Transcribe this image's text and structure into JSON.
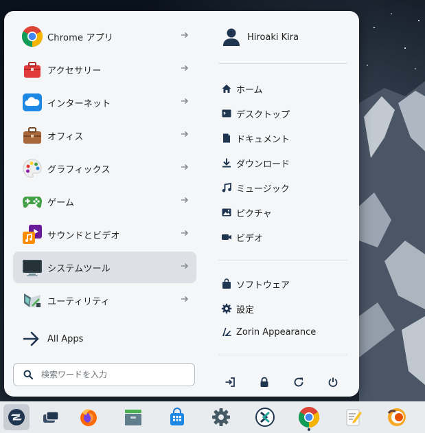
{
  "menu": {
    "categories": [
      {
        "label": "Chrome アプリ",
        "icon": "chrome-icon"
      },
      {
        "label": "アクセサリー",
        "icon": "toolbox-icon"
      },
      {
        "label": "インターネット",
        "icon": "cloud-icon"
      },
      {
        "label": "オフィス",
        "icon": "briefcase-icon"
      },
      {
        "label": "グラフィックス",
        "icon": "palette-icon"
      },
      {
        "label": "ゲーム",
        "icon": "gamepad-icon"
      },
      {
        "label": "サウンドとビデオ",
        "icon": "music-video-icon"
      },
      {
        "label": "システムツール",
        "icon": "monitor-icon",
        "selected": true
      },
      {
        "label": "ユーティリティ",
        "icon": "utilities-icon"
      }
    ],
    "all_apps_label": "All Apps",
    "search": {
      "placeholder": "検索ワードを入力",
      "value": ""
    },
    "user": {
      "name": "Hiroaki Kira"
    },
    "places": [
      {
        "label": "ホーム",
        "icon": "home-icon"
      },
      {
        "label": "デスクトップ",
        "icon": "desktop-icon"
      },
      {
        "label": "ドキュメント",
        "icon": "document-icon"
      },
      {
        "label": "ダウンロード",
        "icon": "download-icon"
      },
      {
        "label": "ミュージック",
        "icon": "music-icon"
      },
      {
        "label": "ピクチャ",
        "icon": "picture-icon"
      },
      {
        "label": "ビデオ",
        "icon": "video-icon"
      }
    ],
    "system": [
      {
        "label": "ソフトウェア",
        "icon": "software-bag-icon"
      },
      {
        "label": "設定",
        "icon": "settings-gear-icon"
      },
      {
        "label": "Zorin Appearance",
        "icon": "zorin-appearance-icon"
      }
    ],
    "power_buttons": [
      "logout-icon",
      "lock-icon",
      "restart-icon",
      "power-icon"
    ]
  },
  "taskbar": {
    "items": [
      "zorin-menu-icon",
      "workspaces-icon",
      "firefox-icon",
      "files-icon",
      "software-store-icon",
      "settings-icon",
      "remote-desktop-icon",
      "chrome-icon",
      "text-editor-icon",
      "app-icon"
    ]
  },
  "colors": {
    "menu_bg": "#f4f6f8",
    "selected_bg": "#dde1e6",
    "icon_dark": "#1f3550",
    "taskbar_bg": "#e9ecef"
  }
}
